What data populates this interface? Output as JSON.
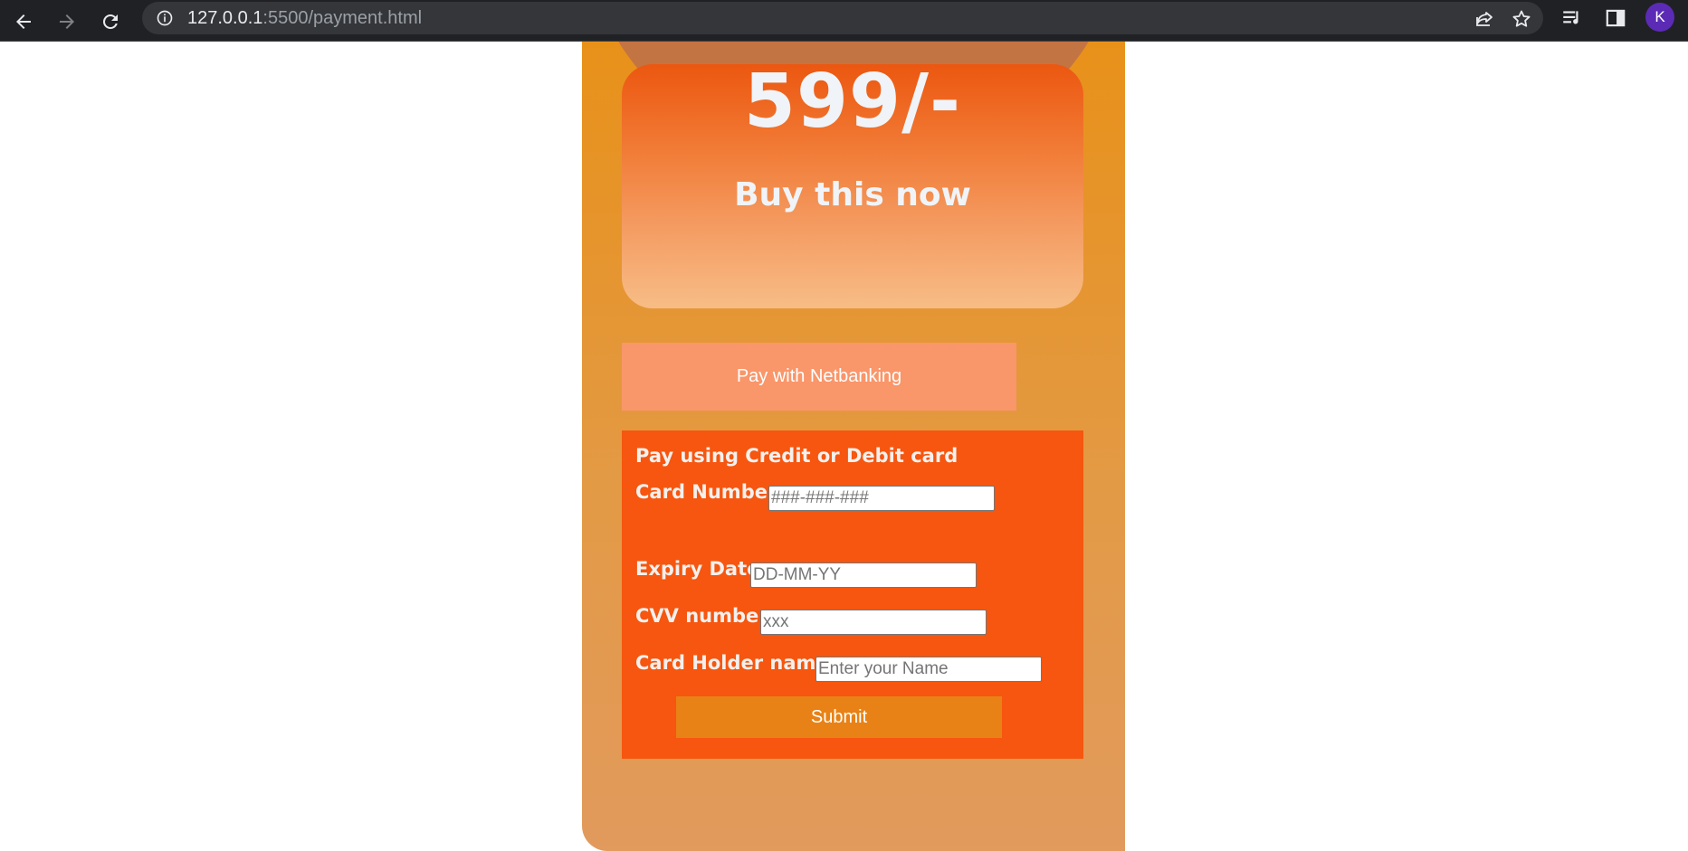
{
  "browser": {
    "url_host": "127.0.0.1",
    "url_rest": ":5500/payment.html",
    "profile_initial": "K"
  },
  "offer": {
    "price": "599/-",
    "cta": "Buy this now"
  },
  "netbanking": {
    "label": "Pay with Netbanking"
  },
  "card_form": {
    "title": "Pay using Credit or Debit card",
    "card_number_label": "Card Number",
    "card_number_placeholder": "###-###-###",
    "expiry_label": "Expiry Date",
    "expiry_placeholder": "DD-MM-YY",
    "cvv_label": "CVV number",
    "cvv_placeholder": "xxx",
    "holder_label": "Card Holder name",
    "holder_placeholder": "Enter your Name",
    "submit_label": "Submit"
  },
  "colors": {
    "accent": "#f6560f",
    "netbanking": "#f9966a",
    "submit": "#e88216"
  }
}
